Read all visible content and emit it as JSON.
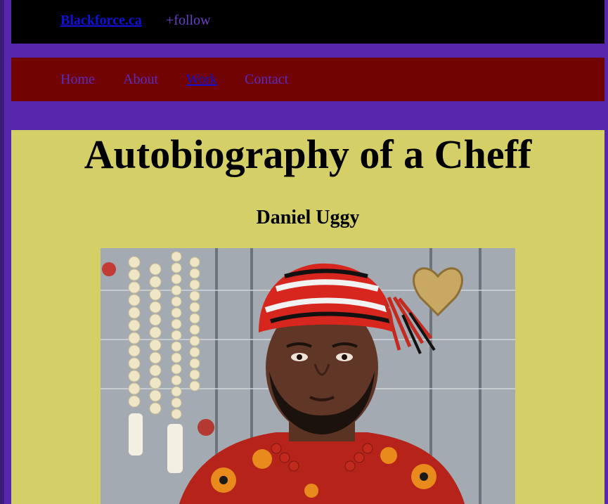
{
  "header": {
    "brand": "Blackforce.ca",
    "follow": "+follow"
  },
  "nav": {
    "items": [
      {
        "label": "Home",
        "active": false
      },
      {
        "label": "About",
        "active": false
      },
      {
        "label": "Work",
        "active": true
      },
      {
        "label": "Contact",
        "active": false
      }
    ]
  },
  "main": {
    "title": "Autobiography of a Cheff",
    "subtitle": "Daniel Uggy"
  },
  "colors": {
    "page_bg": "#5627ad",
    "topbar_bg": "#000000",
    "navbar_bg": "#720303",
    "main_bg": "#d4cf67",
    "link": "#1010d8",
    "muted_link": "#5a2cc0"
  },
  "icons": {
    "photo": "portrait-photo"
  }
}
